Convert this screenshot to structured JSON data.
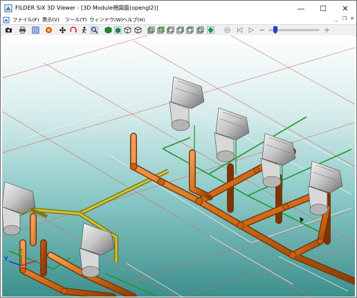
{
  "window": {
    "title": "FILDER SiX 3D Viewer - [3D Module視図面(opengl2)]",
    "controls": {
      "minimize": "—",
      "maximize": "☐",
      "close": "✕"
    }
  },
  "menu": {
    "items": [
      {
        "label": "ファイル(F)"
      },
      {
        "label": "表示(V)"
      },
      {
        "label": "ツール(T)"
      },
      {
        "label": "ウィンドウ(W)"
      },
      {
        "label": "ヘルプ(H)"
      }
    ],
    "mdi": {
      "minimize": "_",
      "restore": "❐",
      "close": "✕"
    }
  },
  "toolbar": {
    "playback": [
      "first-frame-icon",
      "previous-frame-icon",
      "play-icon",
      "stop-icon"
    ],
    "colors": {
      "slider_thumb": "#1e3fd0",
      "gem": "#1e9c35"
    }
  },
  "viewport": {
    "colors": {
      "pipe": "#d16a16",
      "pipe_dark": "#8a3d0a",
      "pipe_highlight": "#f2a05a",
      "yellow_pipe": "#b5ab25",
      "green_line": "#1f9a2e",
      "grid_red": "#d86a6a",
      "fixture": "#bfbfbf",
      "fixture_dark": "#6e6e6e"
    },
    "axis_labels": {
      "x": "X",
      "y": "Y",
      "z": "Z"
    }
  }
}
